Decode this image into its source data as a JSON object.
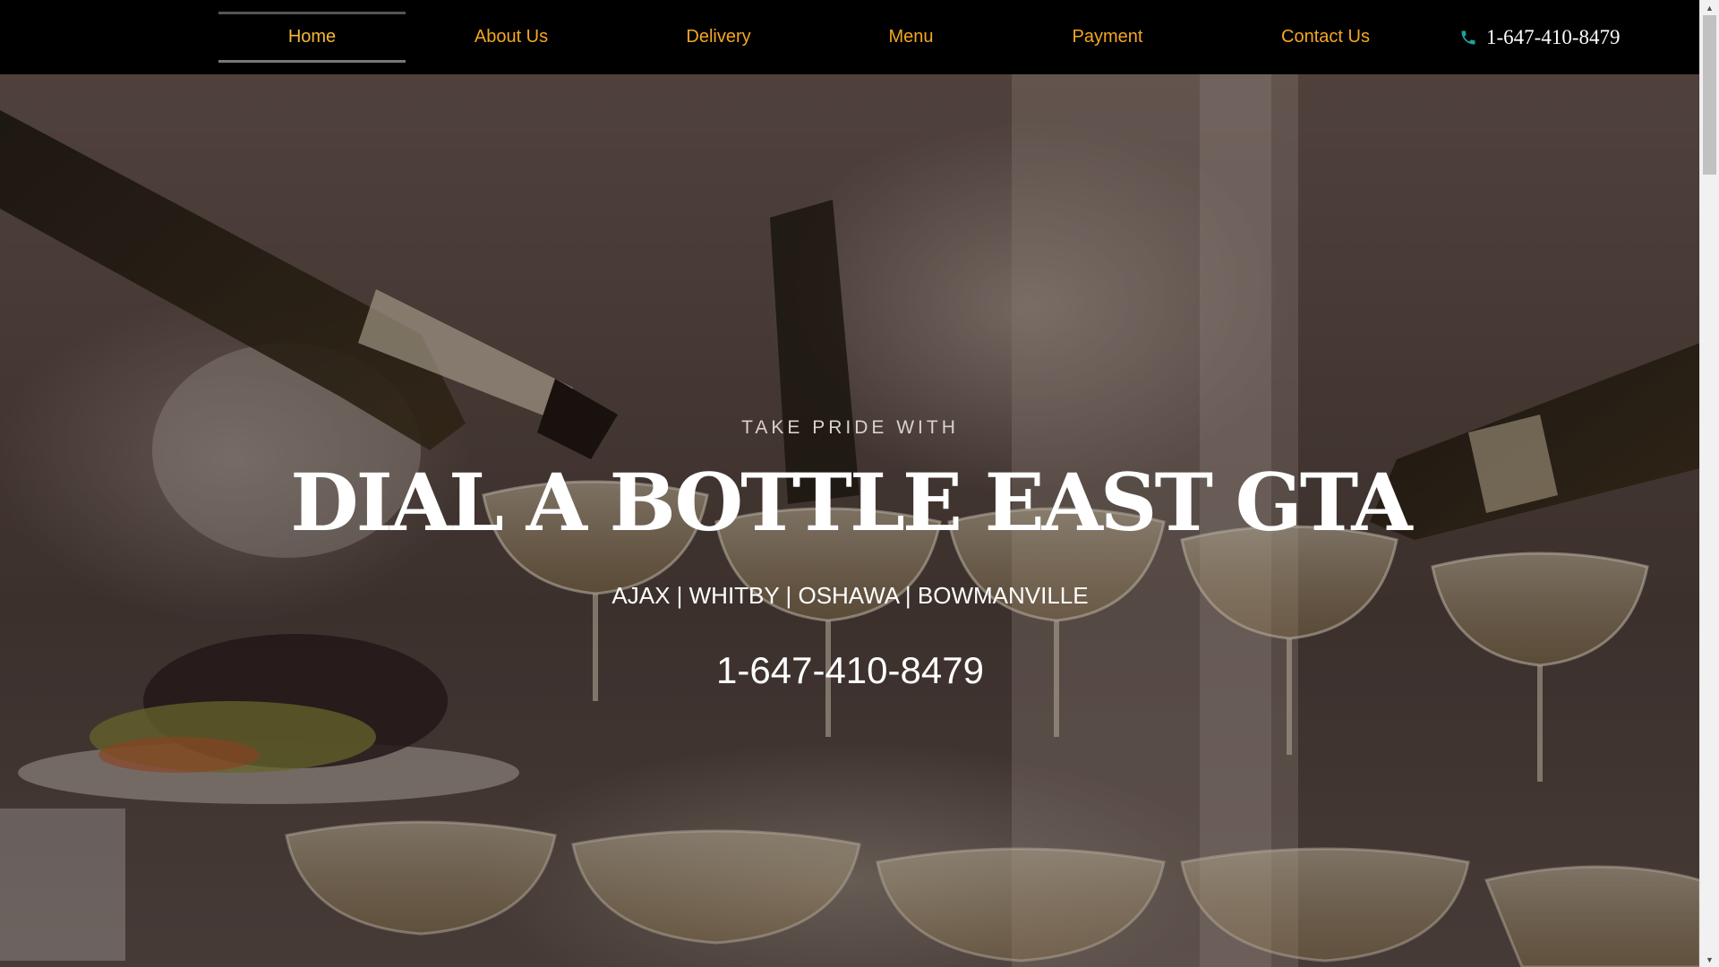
{
  "nav": {
    "items": [
      {
        "label": "Home",
        "active": true
      },
      {
        "label": "About Us",
        "active": false
      },
      {
        "label": "Delivery",
        "active": false
      },
      {
        "label": "Menu",
        "active": false
      },
      {
        "label": "Payment",
        "active": false
      },
      {
        "label": "Contact Us",
        "active": false
      }
    ],
    "phone": "1-647-410-8479",
    "phone_icon": "phone-icon"
  },
  "hero": {
    "eyebrow": "TAKE PRIDE WITH",
    "title": "DIAL A BOTTLE EAST GTA",
    "cities": "AJAX | WHITBY | OSHAWA | BOWMANVILLE",
    "phone": "1-647-410-8479"
  },
  "colors": {
    "nav_background": "#000000",
    "nav_link": "#f5a623",
    "phone_icon": "#1aa39a",
    "hero_text": "#ffffff"
  }
}
